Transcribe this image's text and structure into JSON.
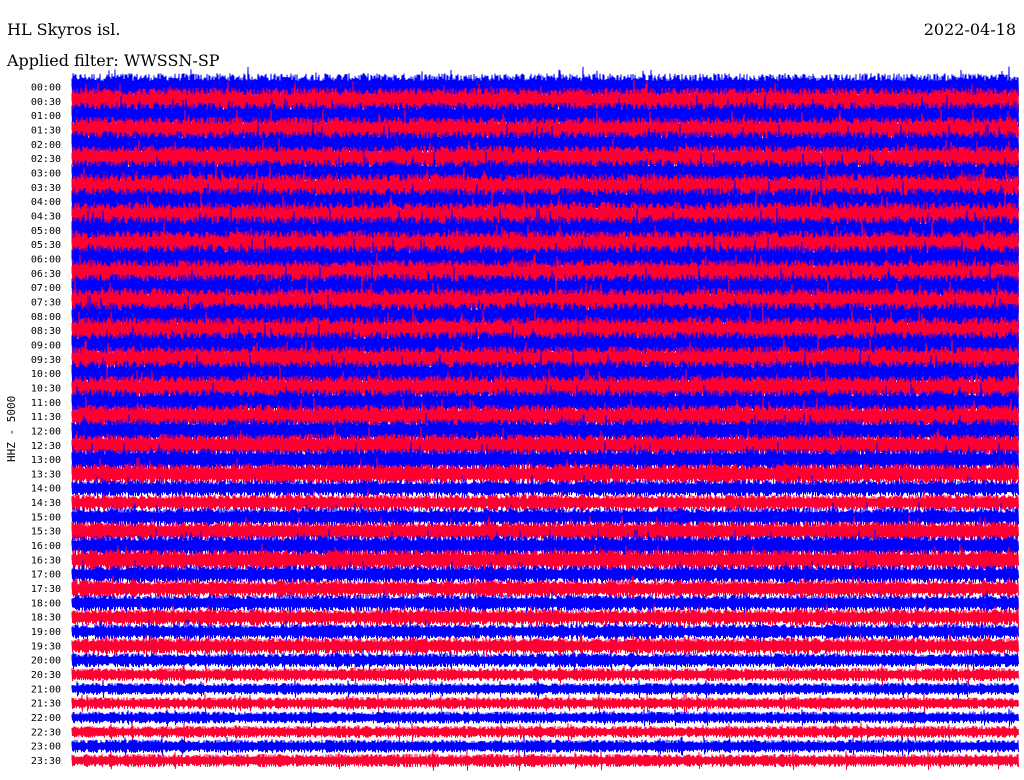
{
  "header": {
    "station": "HL Skyros isl.",
    "date": "2022-04-18",
    "filter_label": "Applied filter: WWSSN-SP"
  },
  "chart_data": {
    "type": "line",
    "title": "HL Skyros isl.",
    "ylabel": "HHZ - 5000",
    "row_labels": [
      "00:00",
      "00:30",
      "01:00",
      "01:30",
      "02:00",
      "02:30",
      "03:00",
      "03:30",
      "04:00",
      "04:30",
      "05:00",
      "05:30",
      "06:00",
      "06:30",
      "07:00",
      "07:30",
      "08:00",
      "08:30",
      "09:00",
      "09:30",
      "10:00",
      "10:30",
      "11:00",
      "11:30",
      "12:00",
      "12:30",
      "13:00",
      "13:30",
      "14:00",
      "14:30",
      "15:00",
      "15:30",
      "16:00",
      "16:30",
      "17:00",
      "17:30",
      "18:00",
      "18:30",
      "19:00",
      "19:30",
      "20:00",
      "20:30",
      "21:00",
      "21:30",
      "22:00",
      "22:30",
      "23:00",
      "23:30"
    ],
    "series_colors": [
      "#0000ff",
      "#ff0033"
    ],
    "relative_amplitude": [
      1.25,
      1.25,
      1.2,
      1.2,
      1.2,
      1.2,
      1.2,
      1.25,
      1.25,
      1.3,
      1.3,
      1.3,
      1.25,
      1.25,
      1.25,
      1.25,
      1.25,
      1.25,
      1.2,
      1.2,
      1.2,
      1.15,
      1.15,
      1.1,
      1.1,
      1.05,
      1.0,
      0.95,
      0.75,
      0.75,
      0.85,
      0.9,
      0.95,
      0.95,
      0.8,
      0.8,
      0.75,
      0.75,
      0.7,
      0.75,
      0.65,
      0.6,
      0.55,
      0.55,
      0.55,
      0.55,
      0.6,
      0.6
    ]
  }
}
